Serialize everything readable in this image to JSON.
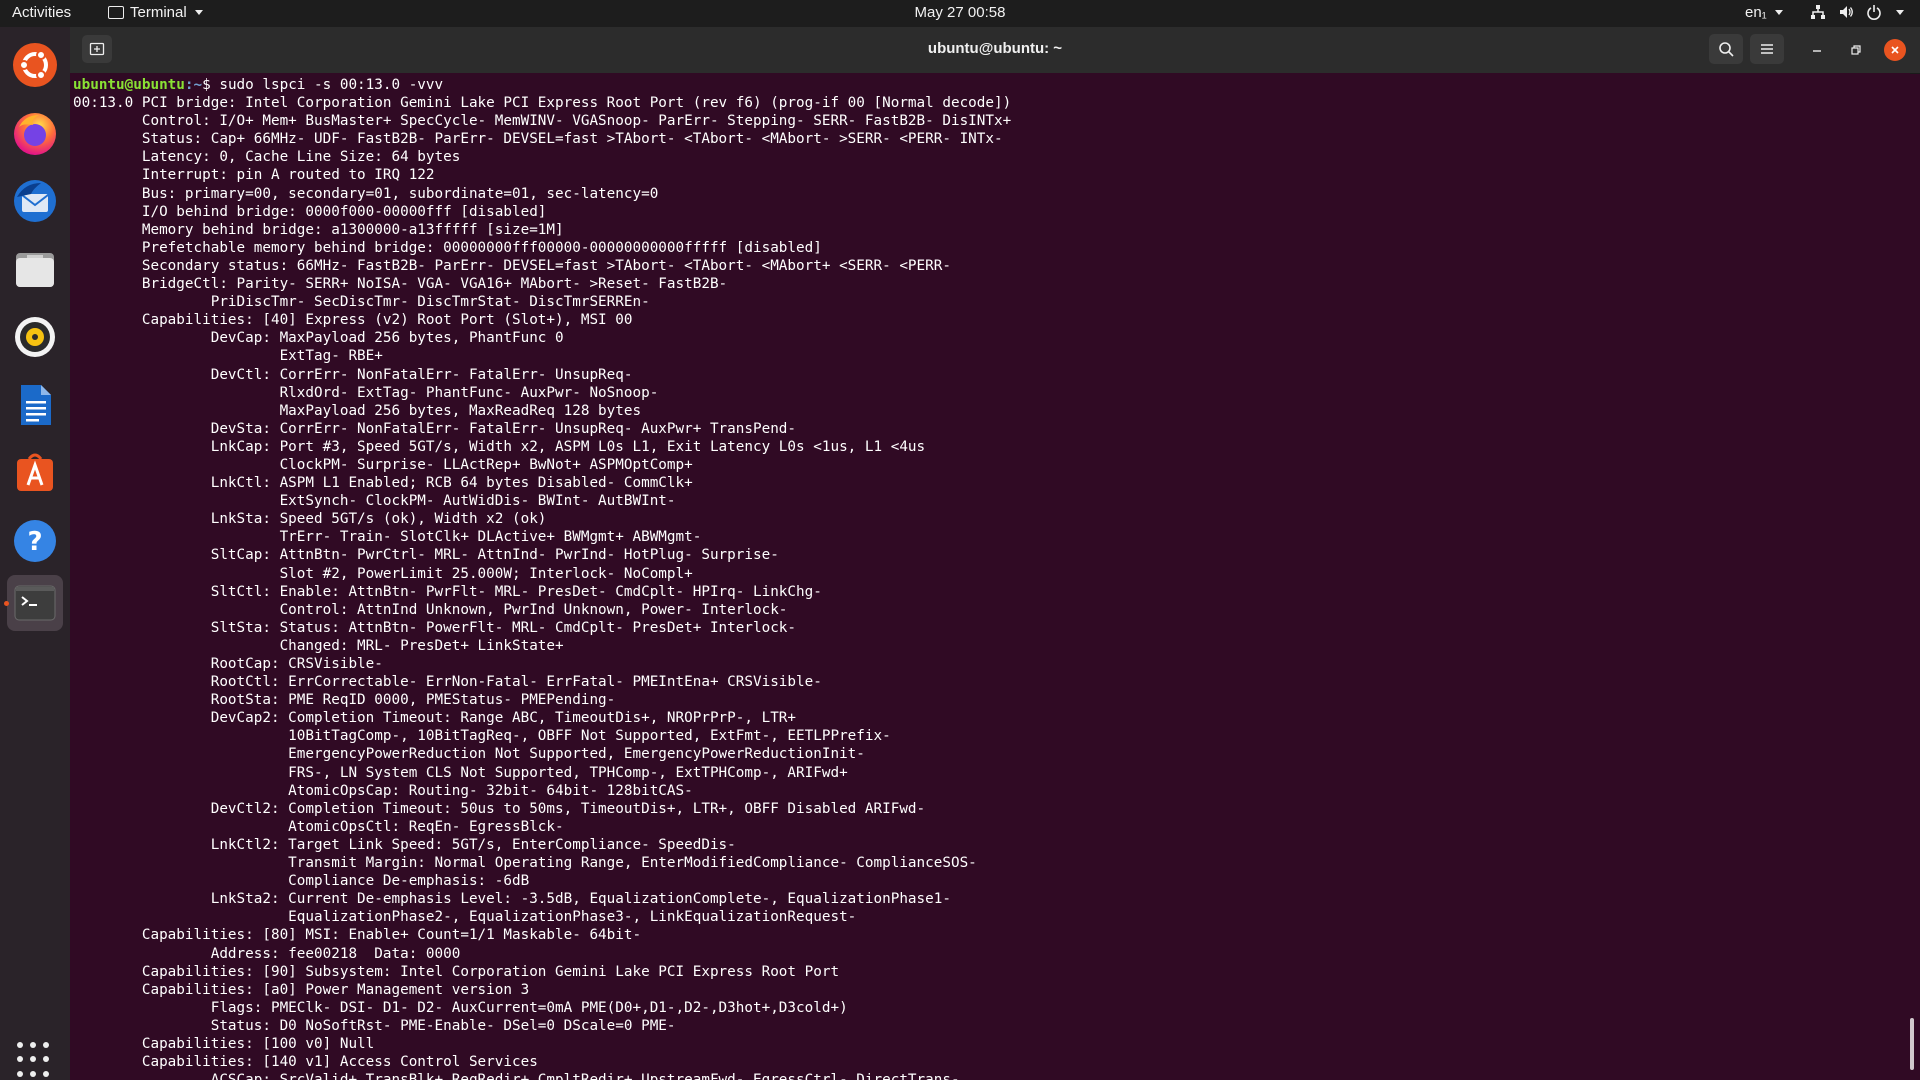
{
  "topbar": {
    "activities": "Activities",
    "app_name": "Terminal",
    "clock": "May 27  00:58",
    "language": "en₁"
  },
  "dock": {
    "items": [
      {
        "name": "Ubuntu"
      },
      {
        "name": "Firefox"
      },
      {
        "name": "Thunderbird"
      },
      {
        "name": "Files"
      },
      {
        "name": "Rhythmbox"
      },
      {
        "name": "LibreOffice Writer"
      },
      {
        "name": "Ubuntu Software"
      },
      {
        "name": "Help"
      },
      {
        "name": "Terminal"
      }
    ]
  },
  "window": {
    "title": "ubuntu@ubuntu: ~"
  },
  "terminal": {
    "prompt_user": "ubuntu@ubuntu",
    "prompt_path": ":~",
    "command": "$ sudo lspci -s 00:13.0 -vvv",
    "lines": [
      "00:13.0 PCI bridge: Intel Corporation Gemini Lake PCI Express Root Port (rev f6) (prog-if 00 [Normal decode])",
      "        Control: I/O+ Mem+ BusMaster+ SpecCycle- MemWINV- VGASnoop- ParErr- Stepping- SERR- FastB2B- DisINTx+",
      "        Status: Cap+ 66MHz- UDF- FastB2B- ParErr- DEVSEL=fast >TAbort- <TAbort- <MAbort- >SERR- <PERR- INTx-",
      "        Latency: 0, Cache Line Size: 64 bytes",
      "        Interrupt: pin A routed to IRQ 122",
      "        Bus: primary=00, secondary=01, subordinate=01, sec-latency=0",
      "        I/O behind bridge: 0000f000-00000fff [disabled]",
      "        Memory behind bridge: a1300000-a13fffff [size=1M]",
      "        Prefetchable memory behind bridge: 00000000fff00000-00000000000fffff [disabled]",
      "        Secondary status: 66MHz- FastB2B- ParErr- DEVSEL=fast >TAbort- <TAbort- <MAbort+ <SERR- <PERR-",
      "        BridgeCtl: Parity- SERR+ NoISA- VGA- VGA16+ MAbort- >Reset- FastB2B-",
      "                PriDiscTmr- SecDiscTmr- DiscTmrStat- DiscTmrSERREn-",
      "        Capabilities: [40] Express (v2) Root Port (Slot+), MSI 00",
      "                DevCap: MaxPayload 256 bytes, PhantFunc 0",
      "                        ExtTag- RBE+",
      "                DevCtl: CorrErr- NonFatalErr- FatalErr- UnsupReq-",
      "                        RlxdOrd- ExtTag- PhantFunc- AuxPwr- NoSnoop-",
      "                        MaxPayload 256 bytes, MaxReadReq 128 bytes",
      "                DevSta: CorrErr- NonFatalErr- FatalErr- UnsupReq- AuxPwr+ TransPend-",
      "                LnkCap: Port #3, Speed 5GT/s, Width x2, ASPM L0s L1, Exit Latency L0s <1us, L1 <4us",
      "                        ClockPM- Surprise- LLActRep+ BwNot+ ASPMOptComp+",
      "                LnkCtl: ASPM L1 Enabled; RCB 64 bytes Disabled- CommClk+",
      "                        ExtSynch- ClockPM- AutWidDis- BWInt- AutBWInt-",
      "                LnkSta: Speed 5GT/s (ok), Width x2 (ok)",
      "                        TrErr- Train- SlotClk+ DLActive+ BWMgmt+ ABWMgmt-",
      "                SltCap: AttnBtn- PwrCtrl- MRL- AttnInd- PwrInd- HotPlug- Surprise-",
      "                        Slot #2, PowerLimit 25.000W; Interlock- NoCompl+",
      "                SltCtl: Enable: AttnBtn- PwrFlt- MRL- PresDet- CmdCplt- HPIrq- LinkChg-",
      "                        Control: AttnInd Unknown, PwrInd Unknown, Power- Interlock-",
      "                SltSta: Status: AttnBtn- PowerFlt- MRL- CmdCplt- PresDet+ Interlock-",
      "                        Changed: MRL- PresDet+ LinkState+",
      "                RootCap: CRSVisible-",
      "                RootCtl: ErrCorrectable- ErrNon-Fatal- ErrFatal- PMEIntEna+ CRSVisible-",
      "                RootSta: PME ReqID 0000, PMEStatus- PMEPending-",
      "                DevCap2: Completion Timeout: Range ABC, TimeoutDis+, NROPrPrP-, LTR+",
      "                         10BitTagComp-, 10BitTagReq-, OBFF Not Supported, ExtFmt-, EETLPPrefix-",
      "                         EmergencyPowerReduction Not Supported, EmergencyPowerReductionInit-",
      "                         FRS-, LN System CLS Not Supported, TPHComp-, ExtTPHComp-, ARIFwd+",
      "                         AtomicOpsCap: Routing- 32bit- 64bit- 128bitCAS-",
      "                DevCtl2: Completion Timeout: 50us to 50ms, TimeoutDis+, LTR+, OBFF Disabled ARIFwd-",
      "                         AtomicOpsCtl: ReqEn- EgressBlck-",
      "                LnkCtl2: Target Link Speed: 5GT/s, EnterCompliance- SpeedDis-",
      "                         Transmit Margin: Normal Operating Range, EnterModifiedCompliance- ComplianceSOS-",
      "                         Compliance De-emphasis: -6dB",
      "                LnkSta2: Current De-emphasis Level: -3.5dB, EqualizationComplete-, EqualizationPhase1-",
      "                         EqualizationPhase2-, EqualizationPhase3-, LinkEqualizationRequest-",
      "        Capabilities: [80] MSI: Enable+ Count=1/1 Maskable- 64bit-",
      "                Address: fee00218  Data: 0000",
      "        Capabilities: [90] Subsystem: Intel Corporation Gemini Lake PCI Express Root Port",
      "        Capabilities: [a0] Power Management version 3",
      "                Flags: PMEClk- DSI- D1- D2- AuxCurrent=0mA PME(D0+,D1-,D2-,D3hot+,D3cold+)",
      "                Status: D0 NoSoftRst- PME-Enable- DSel=0 DScale=0 PME-",
      "        Capabilities: [100 v0] Null",
      "        Capabilities: [140 v1] Access Control Services",
      "                ACSCap: SrcValid+ TransBlk+ ReqRedir+ CmpltRedir+ UpstreamFwd- EgressCtrl- DirectTrans-"
    ]
  }
}
